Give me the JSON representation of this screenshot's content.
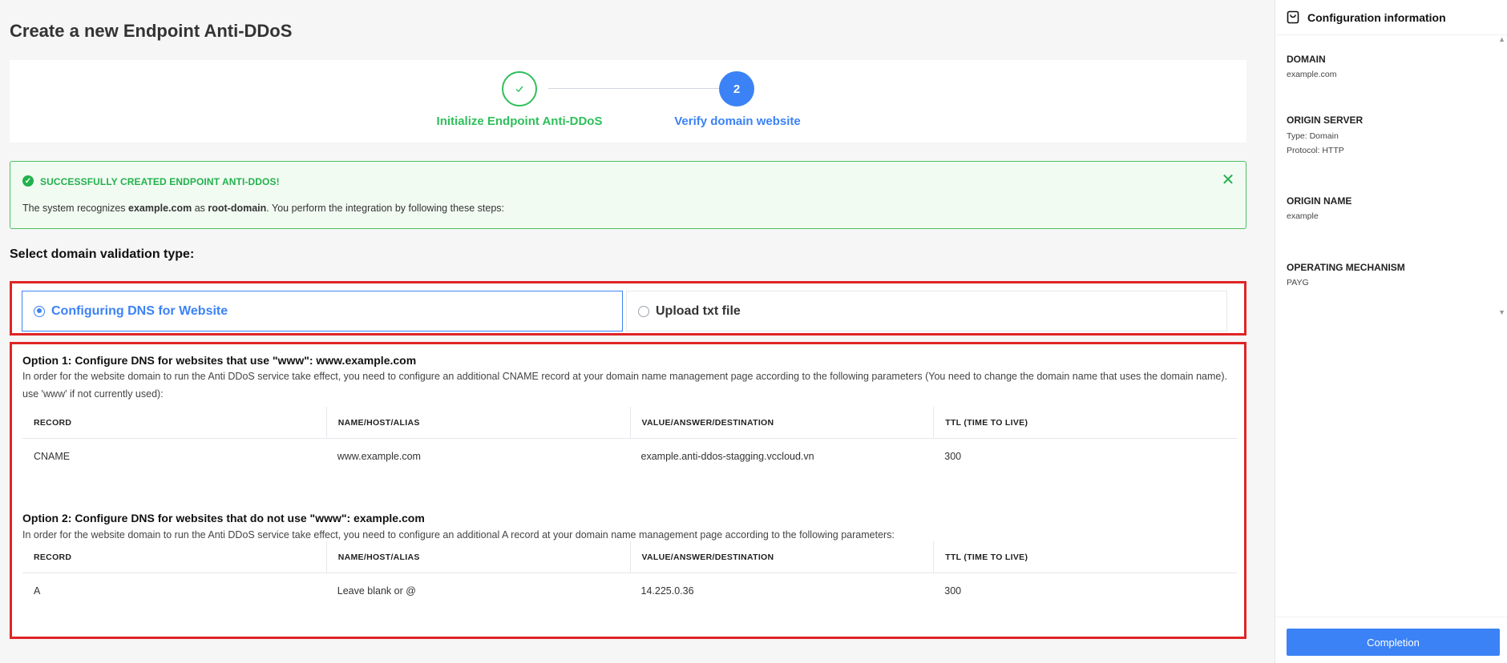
{
  "page": {
    "title": "Create a new Endpoint Anti-DDoS"
  },
  "stepper": {
    "steps": [
      {
        "number": "1",
        "label": "Initialize Endpoint Anti-DDoS",
        "status": "done",
        "icon": "check-icon"
      },
      {
        "number": "2",
        "label": "Verify domain website",
        "status": "active"
      }
    ],
    "done_color": "#2fbf5b",
    "active_color": "#3b82f6"
  },
  "alert": {
    "title": "SUCCESSFULLY CREATED ENDPOINT ANTI-DDOS!",
    "text_prefix": "The system recognizes ",
    "domain": "example.com",
    "text_middle": " as ",
    "root": "root-domain",
    "text_suffix": ". You perform the integration by following these steps:",
    "color": "#22b14c"
  },
  "validation": {
    "label": "Select domain validation type:",
    "options": [
      {
        "label": "Configuring DNS for Website",
        "selected": true
      },
      {
        "label": "Upload txt file",
        "selected": false
      }
    ]
  },
  "option1": {
    "title": "Option 1: Configure DNS for websites that use \"www\": www.example.com",
    "desc": "In order for the website domain to run the Anti DDoS service take effect, you need to configure an additional CNAME record at your domain name management page according to the following parameters (You need to change the domain name that uses the domain name). use 'www' if not currently used):",
    "columns": [
      "RECORD",
      "NAME/HOST/ALIAS",
      "VALUE/ANSWER/DESTINATION",
      "TTL (TIME TO LIVE)"
    ],
    "row": [
      "CNAME",
      "www.example.com",
      "example.anti-ddos-stagging.vccloud.vn",
      "300"
    ]
  },
  "option2": {
    "title": "Option 2: Configure DNS for websites that do not use \"www\": example.com",
    "desc": "In order for the website domain to run the Anti DDoS service take effect, you need to configure an additional A record at your domain name management page according to the following parameters:",
    "columns": [
      "RECORD",
      "NAME/HOST/ALIAS",
      "VALUE/ANSWER/DESTINATION",
      "TTL (TIME TO LIVE)"
    ],
    "row": [
      "A",
      "Leave blank or @",
      "14.225.0.36",
      "300"
    ]
  },
  "sidebar": {
    "title": "Configuration information",
    "icon": "shopping-bag-icon",
    "domain_label": "DOMAIN",
    "domain_value": "example.com",
    "origin_server_label": "ORIGIN SERVER",
    "origin_server_type": "Type: Domain",
    "origin_server_protocol": "Protocol: HTTP",
    "origin_name_label": "ORIGIN NAME",
    "origin_name_value": "example",
    "mechanism_label": "OPERATING MECHANISM",
    "mechanism_value": "PAYG",
    "complete_label": "Completion"
  }
}
